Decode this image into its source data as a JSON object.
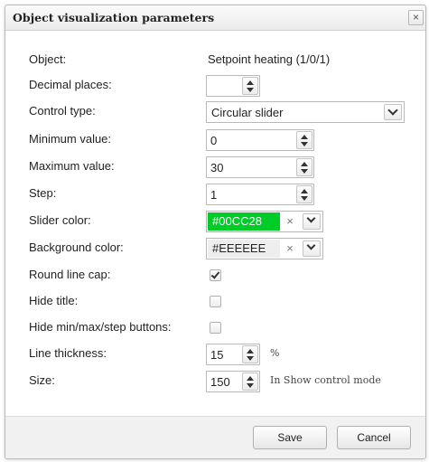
{
  "dialog": {
    "title": "Object visualization parameters",
    "close_symbol": "×"
  },
  "fields": {
    "object": {
      "label": "Object:",
      "value": "Setpoint heating (1/0/1)"
    },
    "decimal_places": {
      "label": "Decimal places:",
      "value": ""
    },
    "control_type": {
      "label": "Control type:",
      "value": "Circular slider"
    },
    "minimum_value": {
      "label": "Minimum value:",
      "value": "0"
    },
    "maximum_value": {
      "label": "Maximum value:",
      "value": "30"
    },
    "step": {
      "label": "Step:",
      "value": "1"
    },
    "slider_color": {
      "label": "Slider color:",
      "value": "#00CC28",
      "swatch": "#00CC28",
      "text_color": "#ffffff"
    },
    "background_color": {
      "label": "Background color:",
      "value": "#EEEEEE",
      "swatch": "#EEEEEE",
      "text_color": "#222222"
    },
    "round_line_cap": {
      "label": "Round line cap:",
      "checked": true
    },
    "hide_title": {
      "label": "Hide title:",
      "checked": false
    },
    "hide_buttons": {
      "label": "Hide min/max/step buttons:",
      "checked": false
    },
    "line_thickness": {
      "label": "Line thickness:",
      "value": "15",
      "suffix": "%"
    },
    "size": {
      "label": "Size:",
      "value": "150",
      "suffix": "In Show control mode"
    }
  },
  "clear_symbol": "×",
  "buttons": {
    "save": "Save",
    "cancel": "Cancel"
  },
  "icons": [
    "close-icon",
    "spin-up-icon",
    "spin-down-icon",
    "chevron-down-icon",
    "clear-icon",
    "checkmark-icon"
  ]
}
